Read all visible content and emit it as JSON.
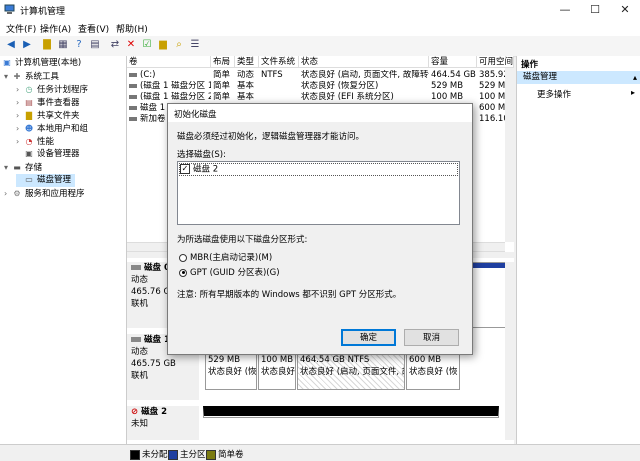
{
  "window": {
    "title": "计算机管理",
    "min": "—",
    "max": "☐",
    "close": "✕"
  },
  "menu": [
    "文件(F)",
    "操作(A)",
    "查看(V)",
    "帮助(H)"
  ],
  "tree": [
    {
      "label": "计算机管理(本地)",
      "level": 0,
      "exp": ""
    },
    {
      "label": "系统工具",
      "level": 1,
      "exp": "▾"
    },
    {
      "label": "任务计划程序",
      "level": 2,
      "exp": "›"
    },
    {
      "label": "事件查看器",
      "level": 2,
      "exp": "›"
    },
    {
      "label": "共享文件夹",
      "level": 2,
      "exp": "›"
    },
    {
      "label": "本地用户和组",
      "level": 2,
      "exp": "›"
    },
    {
      "label": "性能",
      "level": 2,
      "exp": "›"
    },
    {
      "label": "设备管理器",
      "level": 2,
      "exp": ""
    },
    {
      "label": "存储",
      "level": 1,
      "exp": "▾"
    },
    {
      "label": "磁盘管理",
      "level": 2,
      "exp": ""
    },
    {
      "label": "服务和应用程序",
      "level": 1,
      "exp": "›"
    }
  ],
  "volumes": {
    "headers": [
      "卷",
      "布局",
      "类型",
      "文件系统",
      "状态",
      "容量",
      "可用空间"
    ],
    "rows": [
      [
        "(C:)",
        "简单",
        "动态",
        "NTFS",
        "状态良好 (启动, 页面文件, 故障转储)",
        "464.54 GB",
        "385.92 G"
      ],
      [
        "(磁盘 1 磁盘分区 1)",
        "简单",
        "基本",
        "",
        "状态良好 (恢复分区)",
        "529 MB",
        "529 MB"
      ],
      [
        "(磁盘 1 磁盘分区 2)",
        "简单",
        "基本",
        "",
        "状态良好 (EFI 系统分区)",
        "100 MB",
        "100 MB"
      ],
      [
        "磁盘 1",
        "",
        "",
        "",
        "",
        "",
        "600 MB"
      ],
      [
        "新加卷",
        "",
        "",
        "",
        "",
        "",
        "116.10 G"
      ]
    ]
  },
  "disks": [
    {
      "name": "磁盘 0",
      "type": "动态",
      "size": "465.76 GB",
      "status": "联机"
    },
    {
      "name": "磁盘 1",
      "type": "动态",
      "size": "465.75 GB",
      "status": "联机"
    },
    {
      "name": "磁盘 2",
      "type": "未知",
      "size": "",
      "status": ""
    }
  ],
  "disk1_parts": [
    {
      "size": "529 MB",
      "status": "状态良好 (恢"
    },
    {
      "size": "100 MB",
      "status": "状态良好"
    },
    {
      "size": "464.54 GB NTFS",
      "status": "状态良好 (启动, 页面文件, 故"
    },
    {
      "size": "600 MB",
      "status": "状态良好 (恢"
    }
  ],
  "legend": [
    {
      "label": "未分配",
      "color": "#000000"
    },
    {
      "label": "主分区",
      "color": "#1f3fa0"
    },
    {
      "label": "简单卷",
      "color": "#7a7a10"
    }
  ],
  "actions": {
    "header": "操作",
    "section": "磁盘管理",
    "more": "更多操作"
  },
  "dialog": {
    "title": "初始化磁盘",
    "intro": "磁盘必须经过初始化，逻辑磁盘管理器才能访问。",
    "select_label": "选择磁盘(S):",
    "disk_item": "磁盘 2",
    "style_label": "为所选磁盘使用以下磁盘分区形式:",
    "mbr": "MBR(主启动记录)(M)",
    "gpt": "GPT (GUID 分区表)(G)",
    "note": "注意: 所有早期版本的 Windows 都不识别 GPT 分区形式。",
    "ok": "确定",
    "cancel": "取消"
  }
}
